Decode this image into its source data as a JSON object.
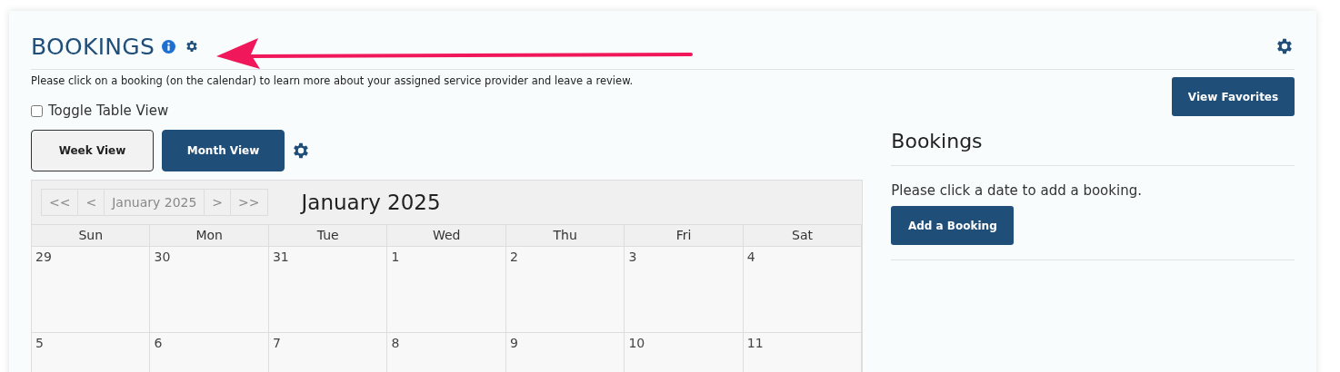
{
  "title": "BOOKINGS",
  "description": "Please click on a booking (on the calendar) to learn more about your assigned service provider and leave a review.",
  "favorites_button": "View Favorites",
  "toggle": {
    "label": "Toggle Table View",
    "checked": false
  },
  "view_buttons": [
    {
      "label": "Week View",
      "selected": false
    },
    {
      "label": "Month View",
      "selected": true
    }
  ],
  "calendar": {
    "nav_buttons": [
      "<<",
      "<",
      "January 2025",
      ">",
      ">>"
    ],
    "title": "January 2025",
    "weekdays": [
      "Sun",
      "Mon",
      "Tue",
      "Wed",
      "Thu",
      "Fri",
      "Sat"
    ],
    "weeks": [
      [
        "29",
        "30",
        "31",
        "1",
        "2",
        "3",
        "4"
      ],
      [
        "5",
        "6",
        "7",
        "8",
        "9",
        "10",
        "11"
      ]
    ]
  },
  "side": {
    "heading": "Bookings",
    "hint": "Please click a date to add a booking.",
    "add_button": "Add a Booking"
  }
}
